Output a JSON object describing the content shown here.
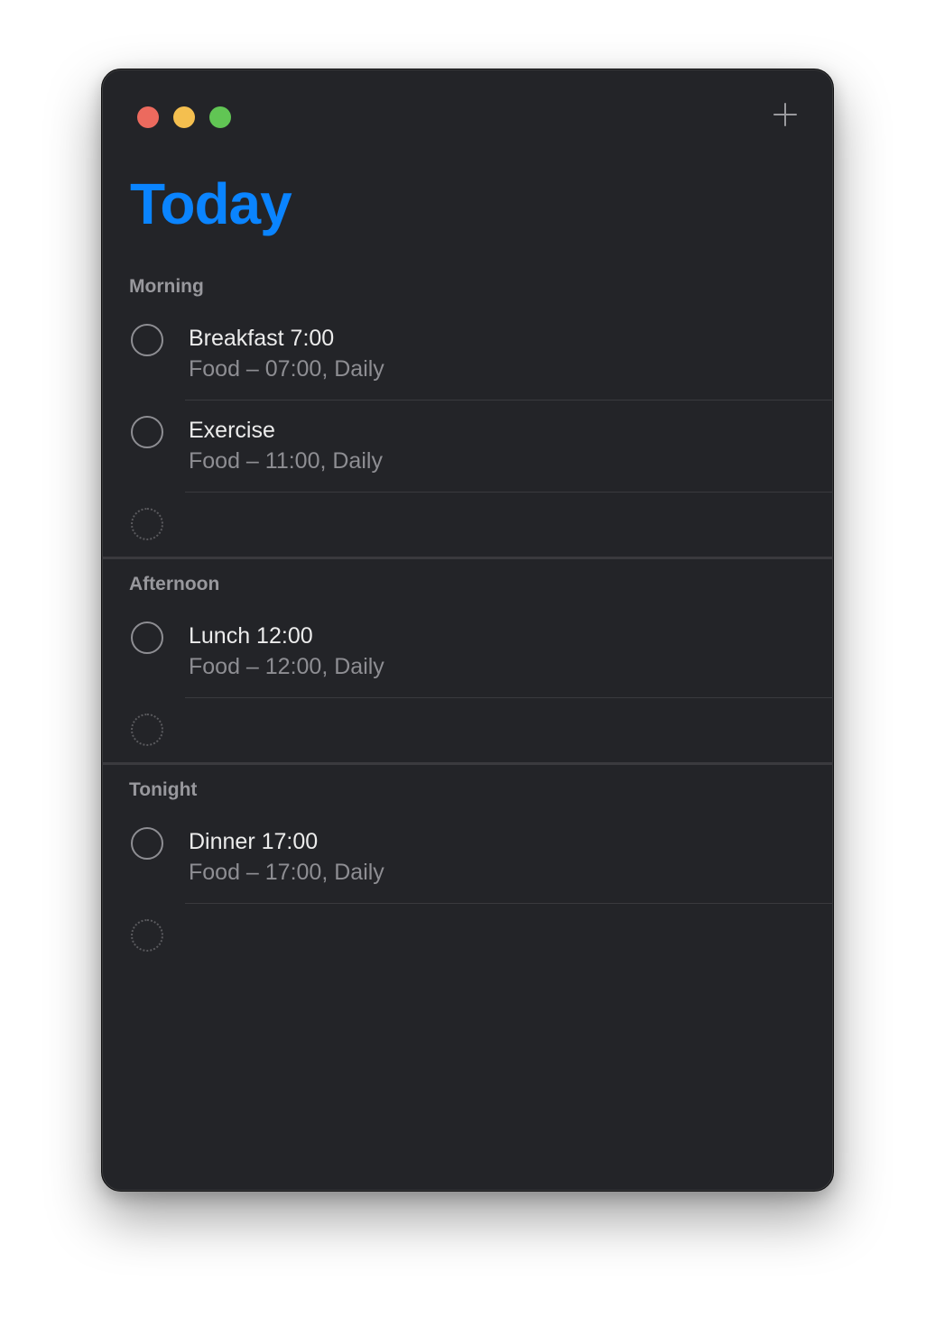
{
  "window": {
    "title": "Today",
    "add_icon": "plus-icon",
    "traffic_lights": [
      "close",
      "minimize",
      "zoom"
    ]
  },
  "sections": [
    {
      "header": "Morning",
      "items": [
        {
          "title": "Breakfast 7:00",
          "subtitle": "Food – 07:00, Daily"
        },
        {
          "title": "Exercise",
          "subtitle": "Food – 11:00, Daily"
        }
      ]
    },
    {
      "header": "Afternoon",
      "items": [
        {
          "title": "Lunch 12:00",
          "subtitle": "Food – 12:00, Daily"
        }
      ]
    },
    {
      "header": "Tonight",
      "items": [
        {
          "title": "Dinner 17:00",
          "subtitle": "Food – 17:00, Daily"
        }
      ]
    }
  ],
  "colors": {
    "accent": "#0a84ff",
    "window_bg": "#232428",
    "close": "#ec6a5e",
    "minimize": "#f4bf4f",
    "zoom": "#61c554"
  }
}
